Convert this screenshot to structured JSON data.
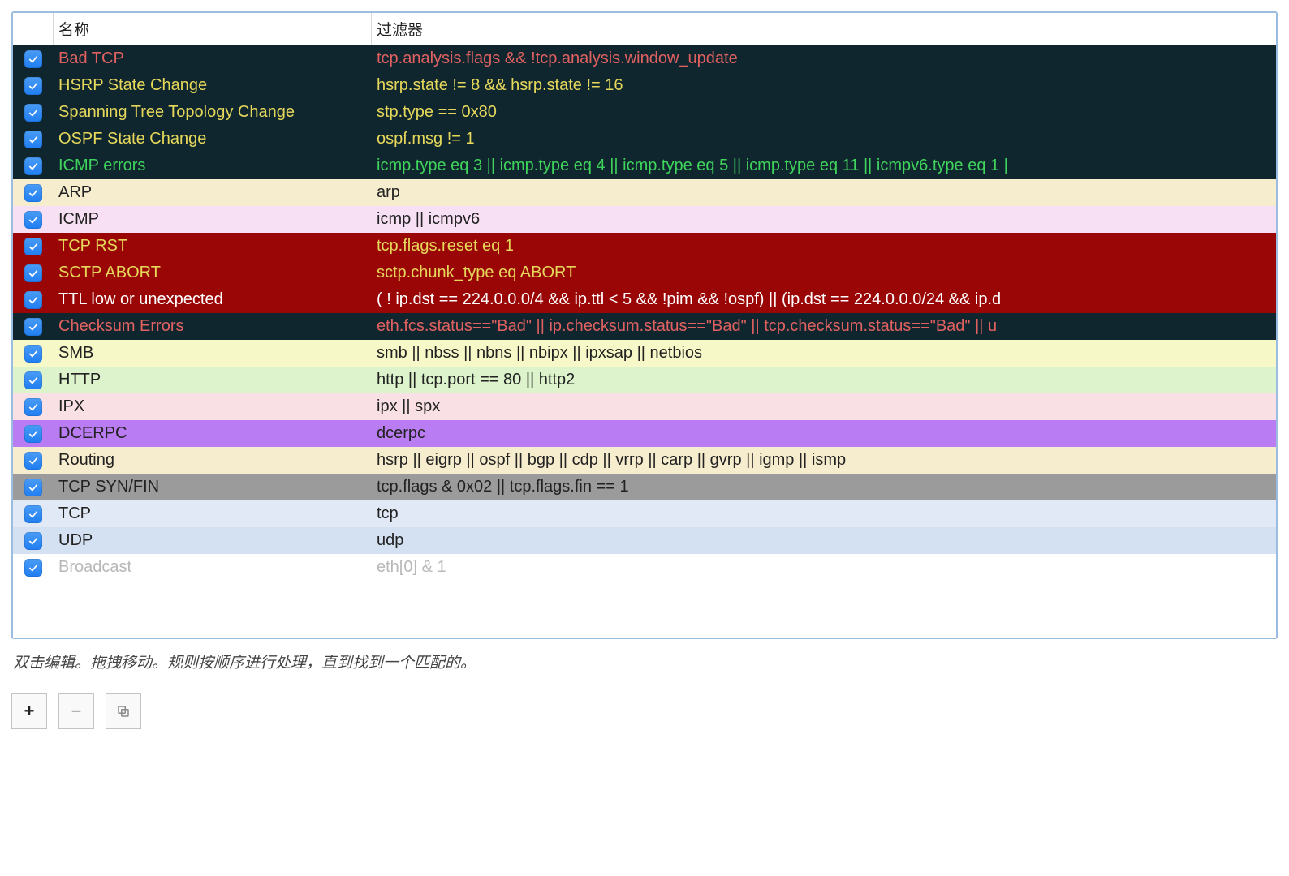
{
  "headers": {
    "name": "名称",
    "filter": "过滤器"
  },
  "hint": "双击编辑。拖拽移动。规则按顺序进行处理，直到找到一个匹配的。",
  "toolbar": {
    "add": "+",
    "remove": "−",
    "copy": "⿻"
  },
  "rules": [
    {
      "checked": true,
      "name": "Bad TCP",
      "filter": "tcp.analysis.flags && !tcp.analysis.window_update",
      "bg": "#10262f",
      "fg": "#e16161"
    },
    {
      "checked": true,
      "name": "HSRP State Change",
      "filter": "hsrp.state != 8 && hsrp.state != 16",
      "bg": "#10262f",
      "fg": "#e6d85a"
    },
    {
      "checked": true,
      "name": "Spanning Tree Topology  Change",
      "filter": "stp.type == 0x80",
      "bg": "#10262f",
      "fg": "#e6d85a"
    },
    {
      "checked": true,
      "name": "OSPF State Change",
      "filter": "ospf.msg != 1",
      "bg": "#10262f",
      "fg": "#e6d85a"
    },
    {
      "checked": true,
      "name": "ICMP errors",
      "filter": "icmp.type eq 3 || icmp.type eq 4 || icmp.type eq 5 || icmp.type eq 11 || icmpv6.type eq 1 |",
      "bg": "#10262f",
      "fg": "#3fd45b"
    },
    {
      "checked": true,
      "name": "ARP",
      "filter": "arp",
      "bg": "#f6ecce",
      "fg": "#222222"
    },
    {
      "checked": true,
      "name": "ICMP",
      "filter": "icmp || icmpv6",
      "bg": "#f8e0f4",
      "fg": "#222222"
    },
    {
      "checked": true,
      "name": "TCP RST",
      "filter": "tcp.flags.reset eq 1",
      "bg": "#9a0605",
      "fg": "#e6d85a"
    },
    {
      "checked": true,
      "name": "SCTP ABORT",
      "filter": "sctp.chunk_type eq ABORT",
      "bg": "#9a0605",
      "fg": "#e6d85a"
    },
    {
      "checked": true,
      "name": "TTL low or unexpected",
      "filter": "( ! ip.dst == 224.0.0.0/4 && ip.ttl < 5 && !pim && !ospf) || (ip.dst == 224.0.0.0/24 && ip.d",
      "bg": "#9a0605",
      "fg": "#ffffff"
    },
    {
      "checked": true,
      "name": "Checksum Errors",
      "filter": "eth.fcs.status==\"Bad\" || ip.checksum.status==\"Bad\" || tcp.checksum.status==\"Bad\" || u",
      "bg": "#10262f",
      "fg": "#e16161"
    },
    {
      "checked": true,
      "name": "SMB",
      "filter": "smb || nbss || nbns || nbipx || ipxsap || netbios",
      "bg": "#f7f8c7",
      "fg": "#222222"
    },
    {
      "checked": true,
      "name": "HTTP",
      "filter": "http || tcp.port == 80 || http2",
      "bg": "#dcf3cb",
      "fg": "#222222"
    },
    {
      "checked": true,
      "name": "IPX",
      "filter": "ipx || spx",
      "bg": "#f8e0e4",
      "fg": "#222222"
    },
    {
      "checked": true,
      "name": "DCERPC",
      "filter": "dcerpc",
      "bg": "#ba7cf2",
      "fg": "#222222"
    },
    {
      "checked": true,
      "name": "Routing",
      "filter": "hsrp || eigrp || ospf || bgp || cdp || vrrp || carp || gvrp || igmp || ismp",
      "bg": "#f6ecce",
      "fg": "#222222"
    },
    {
      "checked": true,
      "name": "TCP SYN/FIN",
      "filter": "tcp.flags & 0x02 || tcp.flags.fin == 1",
      "bg": "#9b9b9b",
      "fg": "#222222"
    },
    {
      "checked": true,
      "name": "TCP",
      "filter": "tcp",
      "bg": "#e1e9f6",
      "fg": "#222222"
    },
    {
      "checked": true,
      "name": "UDP",
      "filter": "udp",
      "bg": "#d3e1f3",
      "fg": "#222222"
    },
    {
      "checked": true,
      "name": "Broadcast",
      "filter": "eth[0] & 1",
      "bg": "#ffffff",
      "fg": "#b8b8b8"
    }
  ]
}
